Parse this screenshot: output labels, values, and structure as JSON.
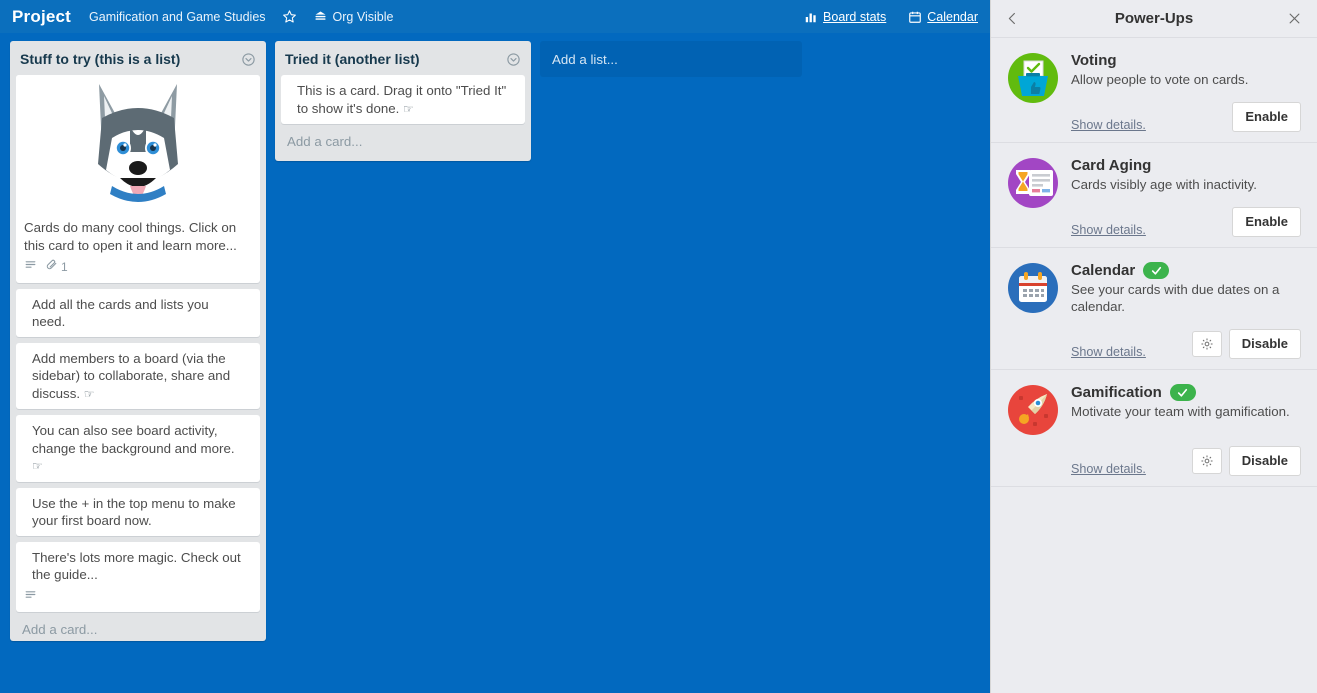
{
  "board": {
    "title": "Project",
    "name": "Gamification and Game Studies",
    "star_icon": "star-icon",
    "visibility_icon": "org-visible-icon",
    "visibility": "Org Visible",
    "board_stats_icon": "bar-chart-icon",
    "board_stats": "Board stats",
    "calendar_icon": "calendar-icon",
    "calendar": "Calendar",
    "bg_color": "#0269bf",
    "header_color": "#0b6fbd",
    "add_list_placeholder": "Add a list...",
    "lists": [
      {
        "title": "Stuff to try (this is a list)",
        "menu_icon": "list-menu-icon",
        "add_card": "Add a card...",
        "cards": [
          {
            "cover": "husky-dog-image",
            "text": "Cards do many cool things. Click on this card to open it and learn more...",
            "badges": {
              "description_icon": "description-icon",
              "attachment_icon": "attachment-icon",
              "attachment_count": "1"
            }
          },
          {
            "text": "Add all the cards and lists you need."
          },
          {
            "text": "Add members to a board (via the sidebar) to collaborate, share and discuss.",
            "hand": "☞"
          },
          {
            "text": "You can also see board activity, change the background and more.",
            "hand": "☞"
          },
          {
            "text": "Use the + in the top menu to make your first board now."
          },
          {
            "text": "There's lots more magic. Check out the guide...",
            "badges": {
              "description_icon": "description-icon"
            }
          }
        ]
      },
      {
        "title": "Tried it (another list)",
        "menu_icon": "list-menu-icon",
        "add_card": "Add a card...",
        "cards": [
          {
            "text": "This is a card. Drag it onto \"Tried It\" to show it's done.",
            "hand": "☞"
          }
        ]
      }
    ]
  },
  "powerups": {
    "title": "Power-Ups",
    "back_icon": "chevron-left-icon",
    "close_icon": "close-icon",
    "bg_color": "#ebecf0",
    "enabled_color": "#3cb34c",
    "items": [
      {
        "icon": "voting-powerup-icon",
        "name": "Voting",
        "description": "Allow people to vote on cards.",
        "details_label": "Show details.",
        "enabled": false,
        "action_label": "Enable"
      },
      {
        "icon": "card-aging-powerup-icon",
        "name": "Card Aging",
        "description": "Cards visibly age with inactivity.",
        "details_label": "Show details.",
        "enabled": false,
        "action_label": "Enable"
      },
      {
        "icon": "calendar-powerup-icon",
        "name": "Calendar",
        "description": "See your cards with due dates on a calendar.",
        "details_label": "Show details.",
        "enabled": true,
        "settings_icon": "gear-icon",
        "action_label": "Disable"
      },
      {
        "icon": "gamification-powerup-icon",
        "name": "Gamification",
        "description": "Motivate your team with gamification.",
        "details_label": "Show details.",
        "enabled": true,
        "settings_icon": "gear-icon",
        "action_label": "Disable"
      }
    ]
  }
}
